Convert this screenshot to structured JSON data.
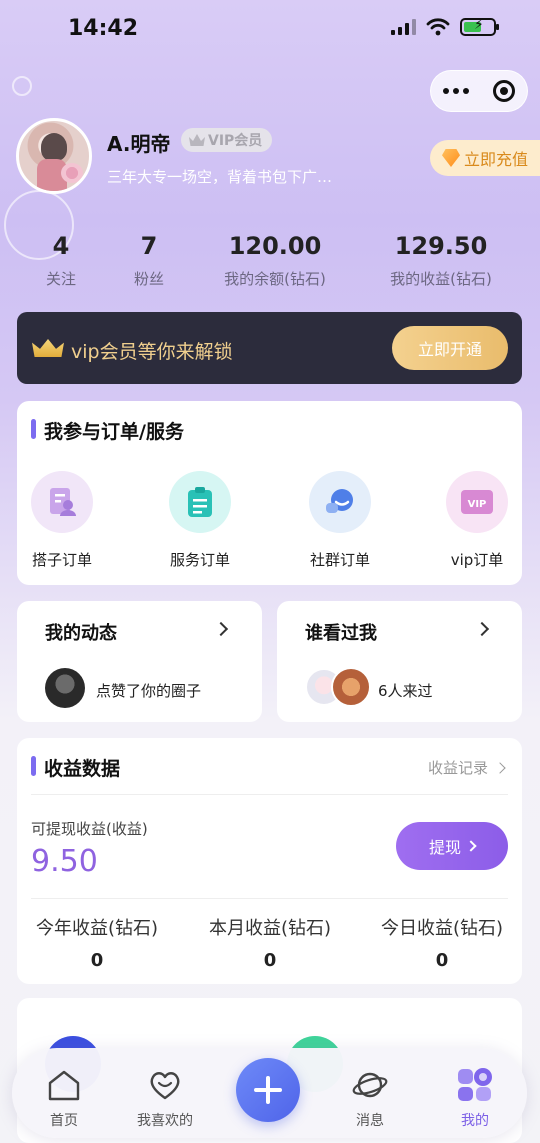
{
  "status": {
    "time": "14:42"
  },
  "profile": {
    "name": "A.明帝",
    "badge": "VIP会员",
    "bio": "三年大专一场空，背着书包下广…",
    "recharge_label": "立即充值"
  },
  "stats": [
    {
      "value": "4",
      "label": "关注"
    },
    {
      "value": "7",
      "label": "粉丝"
    },
    {
      "value": "120.00",
      "label": "我的余额(钻石)"
    },
    {
      "value": "129.50",
      "label": "我的收益(钻石)"
    }
  ],
  "vip_banner": {
    "text": "vip会员等你来解锁",
    "button": "立即开通"
  },
  "orders": {
    "title": "我参与订单/服务",
    "items": [
      {
        "label": "搭子订单",
        "icon": "partner-order-icon"
      },
      {
        "label": "服务订单",
        "icon": "service-order-icon"
      },
      {
        "label": "社群订单",
        "icon": "community-order-icon"
      },
      {
        "label": "vip订单",
        "icon": "vip-order-icon"
      }
    ]
  },
  "dynamics": {
    "title": "我的动态",
    "text": "点赞了你的圈子"
  },
  "visitors": {
    "title": "谁看过我",
    "text": "6人来过"
  },
  "earnings": {
    "title": "收益数据",
    "record_link": "收益记录",
    "withdrawable_label": "可提现收益(收益)",
    "withdrawable_value": "9.50",
    "withdraw_button": "提现",
    "columns": [
      {
        "label": "今年收益(钻石)",
        "value": "0"
      },
      {
        "label": "本月收益(钻石)",
        "value": "0"
      },
      {
        "label": "今日收益(钻石)",
        "value": "0"
      }
    ]
  },
  "tabbar": {
    "items": [
      "首页",
      "我喜欢的",
      "消息",
      "我的"
    ],
    "active": "我的"
  },
  "colors": {
    "accent": "#8f63e0",
    "vip_gold": "#f0cf8e",
    "banner_bg": "#2c2c3c"
  }
}
